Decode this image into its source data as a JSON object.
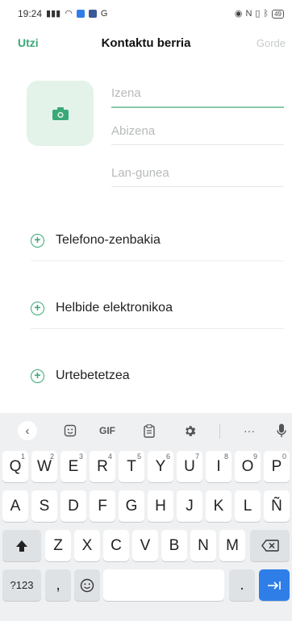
{
  "status_bar": {
    "time": "19:24",
    "left_icons": [
      "signal-icon",
      "wifi-icon",
      "app-notification-icon",
      "facebook-icon",
      "g-icon"
    ],
    "left_glyph_g": "G",
    "right_icons": [
      "eye-icon",
      "nfc-icon",
      "vibrate-icon",
      "bluetooth-icon",
      "battery-icon"
    ],
    "battery": "49"
  },
  "app_bar": {
    "cancel_label": "Utzi",
    "title": "Kontaktu berria",
    "save_label": "Gorde"
  },
  "form": {
    "photo_icon": "camera-icon",
    "first_name_placeholder": "Izena",
    "last_name_placeholder": "Abizena",
    "company_placeholder": "Lan-gunea"
  },
  "add_rows": [
    {
      "label": "Telefono-zenbakia",
      "icon": "plus-circle-icon"
    },
    {
      "label": "Helbide elektronikoa",
      "icon": "plus-circle-icon"
    },
    {
      "label": "Urtebetetzea",
      "icon": "plus-circle-icon"
    }
  ],
  "keyboard": {
    "toolbar": {
      "back": "‹",
      "gif": "GIF",
      "more": "···"
    },
    "row1": [
      {
        "k": "Q",
        "s": "1"
      },
      {
        "k": "W",
        "s": "2"
      },
      {
        "k": "E",
        "s": "3"
      },
      {
        "k": "R",
        "s": "4"
      },
      {
        "k": "T",
        "s": "5"
      },
      {
        "k": "Y",
        "s": "6"
      },
      {
        "k": "U",
        "s": "7"
      },
      {
        "k": "I",
        "s": "8"
      },
      {
        "k": "O",
        "s": "9"
      },
      {
        "k": "P",
        "s": "0"
      }
    ],
    "row2": [
      "A",
      "S",
      "D",
      "F",
      "G",
      "H",
      "J",
      "K",
      "L",
      "Ñ"
    ],
    "row3": [
      "Z",
      "X",
      "C",
      "V",
      "B",
      "N",
      "M"
    ],
    "row4": {
      "symbols": "?123",
      "comma": ",",
      "period": "."
    },
    "accent_color": "#2f7ee8"
  },
  "colors": {
    "accent_green": "#3aa877",
    "photo_bg": "#e4f3ea"
  }
}
